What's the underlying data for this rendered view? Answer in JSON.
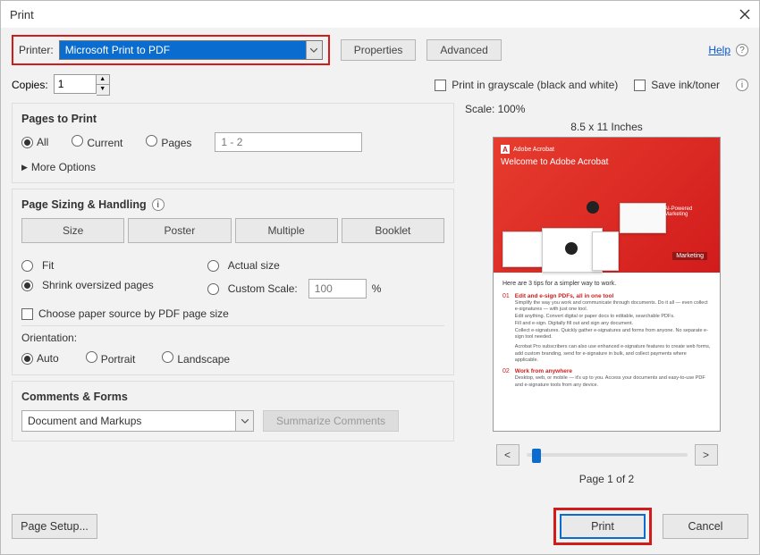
{
  "window": {
    "title": "Print"
  },
  "help_link": "Help",
  "printer": {
    "label": "Printer:",
    "selected": "Microsoft Print to PDF",
    "properties_btn": "Properties",
    "advanced_btn": "Advanced"
  },
  "copies": {
    "label": "Copies:",
    "value": "1"
  },
  "grayscale": {
    "label": "Print in grayscale (black and white)"
  },
  "save_ink": {
    "label": "Save ink/toner"
  },
  "pages_to_print": {
    "heading": "Pages to Print",
    "all": "All",
    "current": "Current",
    "pages": "Pages",
    "range": "1 - 2",
    "more_options": "More Options"
  },
  "sizing": {
    "heading": "Page Sizing & Handling",
    "size_btn": "Size",
    "poster_btn": "Poster",
    "multiple_btn": "Multiple",
    "booklet_btn": "Booklet",
    "fit": "Fit",
    "actual": "Actual size",
    "shrink": "Shrink oversized pages",
    "custom": "Custom Scale:",
    "custom_val": "100",
    "percent": "%",
    "choose_paper": "Choose paper source by PDF page size"
  },
  "orientation": {
    "heading": "Orientation:",
    "auto": "Auto",
    "portrait": "Portrait",
    "landscape": "Landscape"
  },
  "comments": {
    "heading": "Comments & Forms",
    "selected": "Document and Markups",
    "summarize_btn": "Summarize Comments"
  },
  "preview": {
    "scale": "Scale: 100%",
    "dimensions": "8.5 x 11 Inches",
    "doc_brand": "Adobe Acrobat",
    "doc_title": "Welcome to Adobe Acrobat",
    "ai_label": "AI-Powered Marketing",
    "mk_tag": "Marketing",
    "lead": "Here are 3 tips for a simpler way to work.",
    "items": [
      {
        "num": "01",
        "title": "Edit and e-sign PDFs, all in one tool",
        "desc1": "Simplify the way you work and communicate through documents. Do it all — even collect e-signatures — with just one tool.",
        "desc2": "Edit anything. Convert digital or paper docs to editable, searchable PDFs.",
        "desc3": "Fill and e-sign. Digitally fill out and sign any document.",
        "desc4": "Collect e-signatures. Quickly gather e-signatures and forms from anyone. No separate e-sign tool needed.",
        "desc5": "Acrobat Pro subscribers can also use enhanced e-signature features to create web forms, add custom branding, send for e-signature in bulk, and collect payments where applicable."
      },
      {
        "num": "02",
        "title": "Work from anywhere",
        "desc1": "Desktop, web, or mobile — it's up to you. Access your documents and easy-to-use PDF and e-signature tools from any device."
      }
    ],
    "prev": "<",
    "next": ">",
    "page_label": "Page 1 of 2"
  },
  "footer": {
    "page_setup": "Page Setup...",
    "print": "Print",
    "cancel": "Cancel"
  }
}
